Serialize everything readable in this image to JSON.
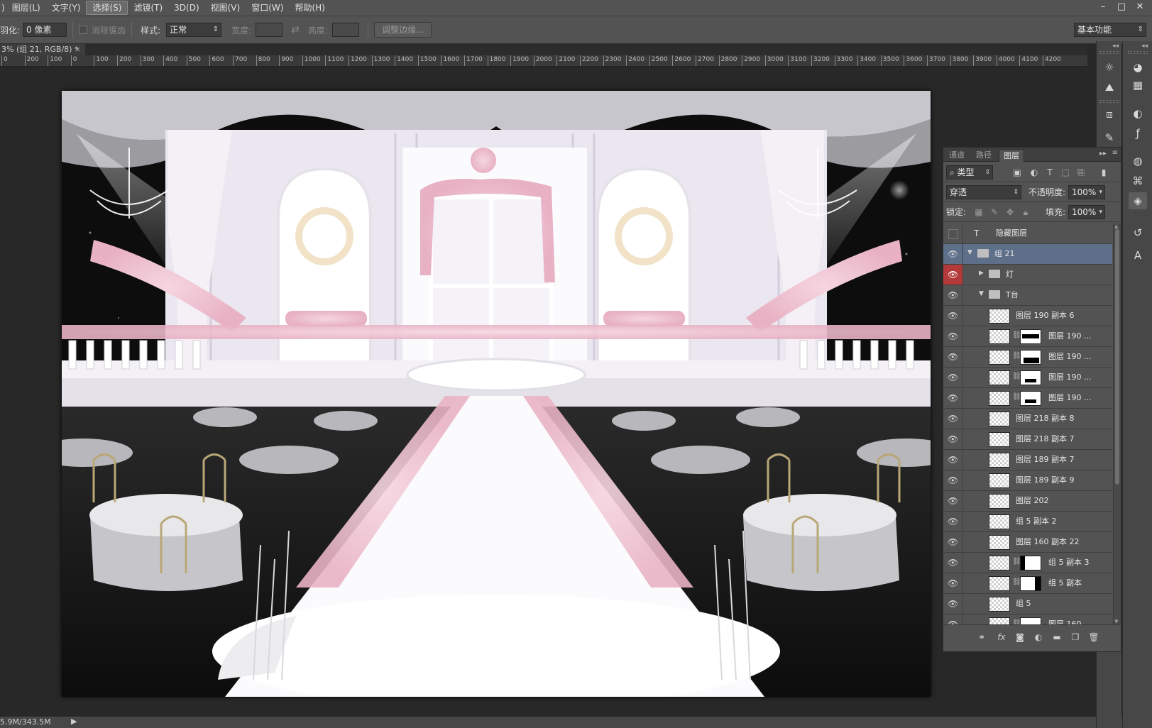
{
  "menubar": {
    "items": [
      "图层(L)",
      "文字(Y)",
      "选择(S)",
      "滤镜(T)",
      "3D(D)",
      "视图(V)",
      "窗口(W)",
      "帮助(H)"
    ],
    "first_partial": ")",
    "window_controls": [
      "–",
      "□",
      "✕"
    ]
  },
  "options": {
    "feather_label": "羽化:",
    "feather_value": "0 像素",
    "antialias_label": "消除锯齿",
    "style_label": "样式:",
    "style_value": "正常",
    "width_label": "宽度:",
    "height_label": "高度:",
    "swap_icon": "⇄",
    "refine_edge_label": "调整边缘...",
    "workspace_value": "基本功能"
  },
  "document": {
    "tab_title": "3% (组 21, RGB/8) *",
    "close": "×"
  },
  "ruler": {
    "labels": [
      "0",
      "200",
      "100",
      "0",
      "100",
      "200",
      "300",
      "400",
      "500",
      "600",
      "700",
      "800",
      "900",
      "1000",
      "1100",
      "1200",
      "1300",
      "1400",
      "1500",
      "1600",
      "1700",
      "1800",
      "1900",
      "2000",
      "2100",
      "2200",
      "2300",
      "2400",
      "2500",
      "2600",
      "2700",
      "2800",
      "2900",
      "3000",
      "3100",
      "3200",
      "3300",
      "3400",
      "3500",
      "3600",
      "3700",
      "3800",
      "3900",
      "4000",
      "4100",
      "4200"
    ]
  },
  "status": {
    "doc_size": "5.9M/343.5M",
    "arrow": "▶"
  },
  "layers_panel": {
    "tabs": [
      "通道",
      "路径",
      "图层"
    ],
    "active_tab": "图层",
    "collapse_icon": "▸▸",
    "menu_icon": "≡",
    "filter_label": "类型",
    "blend_mode": "穿透",
    "opacity_label": "不透明度:",
    "opacity_value": "100%",
    "lock_label": "锁定:",
    "fill_label": "填充:",
    "fill_value": "100%",
    "layers": [
      {
        "name": "隐藏图层",
        "kind": "text",
        "visible": false,
        "indent": 0
      },
      {
        "name": "组 21",
        "kind": "group",
        "visible": true,
        "expanded": true,
        "indent": 0,
        "selected": true
      },
      {
        "name": "灯",
        "kind": "group",
        "visible": true,
        "expanded": false,
        "indent": 1,
        "eye_red": true
      },
      {
        "name": "T台",
        "kind": "group",
        "visible": true,
        "expanded": true,
        "indent": 1
      },
      {
        "name": "图层 190 副本 6",
        "kind": "layer",
        "visible": true,
        "indent": 2
      },
      {
        "name": "图层 190 ...",
        "kind": "layer-mask",
        "visible": true,
        "indent": 2,
        "mask": "a"
      },
      {
        "name": "图层 190 ...",
        "kind": "layer-mask",
        "visible": true,
        "indent": 2,
        "mask": "b"
      },
      {
        "name": "图层 190 ...",
        "kind": "layer-mask",
        "visible": true,
        "indent": 2,
        "mask": "c"
      },
      {
        "name": "图层 190 ...",
        "kind": "layer-mask",
        "visible": true,
        "indent": 2,
        "mask": "c"
      },
      {
        "name": "图层 218 副本 8",
        "kind": "layer",
        "visible": true,
        "indent": 2
      },
      {
        "name": "图层 218 副本 7",
        "kind": "layer",
        "visible": true,
        "indent": 2
      },
      {
        "name": "图层 189 副本 7",
        "kind": "layer",
        "visible": true,
        "indent": 2
      },
      {
        "name": "图层 189 副本 9",
        "kind": "layer",
        "visible": true,
        "indent": 2
      },
      {
        "name": "图层 202",
        "kind": "layer",
        "visible": true,
        "indent": 2
      },
      {
        "name": "组 5 副本 2",
        "kind": "layer",
        "visible": true,
        "indent": 2
      },
      {
        "name": "图层 160 副本 22",
        "kind": "layer",
        "visible": true,
        "indent": 2
      },
      {
        "name": "组 5 副本 3",
        "kind": "layer-mask",
        "visible": true,
        "indent": 2,
        "mask": "d"
      },
      {
        "name": "组 5 副本",
        "kind": "layer-mask",
        "visible": true,
        "indent": 2,
        "mask": "e"
      },
      {
        "name": "组 5",
        "kind": "layer",
        "visible": true,
        "indent": 2
      },
      {
        "name": "图层 160 ...",
        "kind": "layer-mask",
        "visible": true,
        "indent": 2,
        "mask": "f"
      }
    ],
    "footer_icons": [
      "link-icon",
      "fx-icon",
      "mask-icon",
      "adjustment-icon",
      "folder-icon",
      "new-layer-icon",
      "trash-icon"
    ]
  },
  "colors": {
    "ui_dark": "#535353",
    "canvas_bg": "#282828",
    "selection": "#5e6f8a",
    "eye_red": "#b33a3a"
  }
}
